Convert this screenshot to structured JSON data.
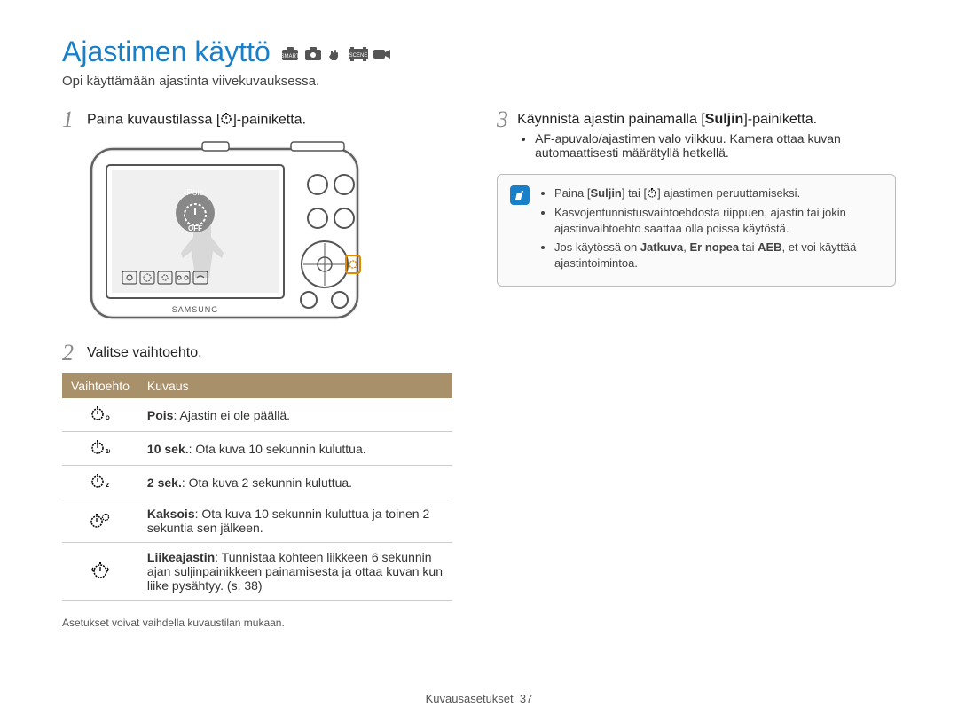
{
  "title": "Ajastimen käyttö",
  "subtitle": "Opi käyttämään ajastinta viivekuvauksessa.",
  "left": {
    "step1_num": "1",
    "step1_prefix": "Paina kuvaustilassa [",
    "step1_suffix": "]-painiketta.",
    "camera_label_pois": "Pois",
    "camera_label_off": "OFF",
    "camera_brand": "SAMSUNG",
    "step2_num": "2",
    "step2_text": "Valitse vaihtoehto.",
    "table_h1": "Vaihtoehto",
    "table_h2": "Kuvaus",
    "rows": {
      "r0_bold": "Pois",
      "r0_rest": ": Ajastin ei ole päällä.",
      "r1_bold": "10 sek.",
      "r1_rest": ": Ota kuva 10 sekunnin kuluttua.",
      "r2_bold": "2 sek.",
      "r2_rest": ": Ota kuva 2 sekunnin kuluttua.",
      "r3_bold": "Kaksois",
      "r3_rest": ": Ota kuva 10 sekunnin kuluttua ja toinen 2 sekuntia sen jälkeen.",
      "r4_bold": "Liikeajastin",
      "r4_rest": ": Tunnistaa kohteen liikkeen 6 sekunnin ajan suljinpainikkeen painamisesta ja ottaa kuvan kun liike pysähtyy. (s. 38)"
    },
    "footnote": "Asetukset voivat vaihdella kuvaustilan mukaan."
  },
  "right": {
    "step3_num": "3",
    "step3_prefix": "Käynnistä ajastin painamalla [",
    "step3_bold": "Suljin",
    "step3_suffix": "]-painiketta.",
    "bullet1": "AF-apuvalo/ajastimen valo vilkkuu. Kamera ottaa kuvan automaattisesti määrätyllä hetkellä.",
    "note0_a": "Paina [",
    "note0_b": "Suljin",
    "note0_c": "] tai [",
    "note0_d": "] ajastimen peruuttamiseksi.",
    "note1": "Kasvojentunnistusvaihtoehdosta riippuen, ajastin tai jokin ajastinvaihtoehto saattaa olla poissa käytöstä.",
    "note2_a": "Jos käytössä on ",
    "note2_b": "Jatkuva",
    "note2_c": ", ",
    "note2_d": "Er nopea",
    "note2_e": " tai ",
    "note2_f": "AEB",
    "note2_g": ", et voi käyttää ajastintoimintoa."
  },
  "pagefoot_section": "Kuvausasetukset",
  "pagefoot_num": "37"
}
